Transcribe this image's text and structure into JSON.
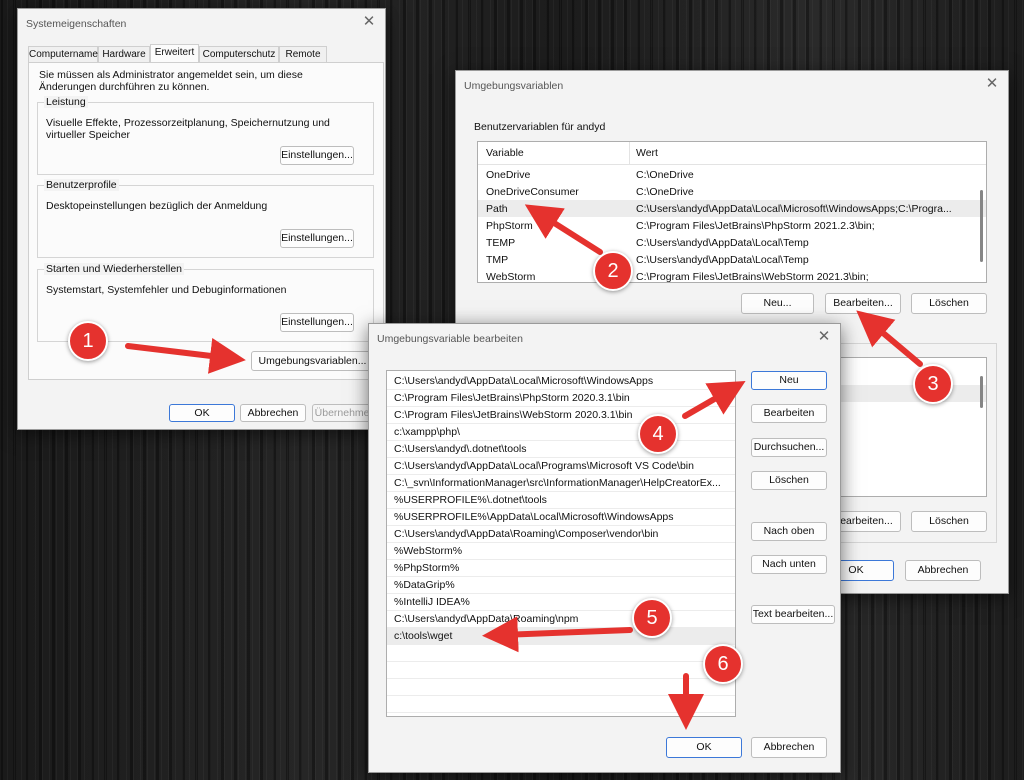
{
  "sys": {
    "title": "Systemeigenschaften",
    "tabs": [
      "Computername",
      "Hardware",
      "Erweitert",
      "Computerschutz",
      "Remote"
    ],
    "admin_note": "Sie müssen als Administrator angemeldet sein, um diese Änderungen durchführen zu können.",
    "leistung": {
      "title": "Leistung",
      "text": "Visuelle Effekte, Prozessorzeitplanung, Speichernutzung und virtueller Speicher",
      "button": "Einstellungen..."
    },
    "profile": {
      "title": "Benutzerprofile",
      "text": "Desktopeinstellungen bezüglich der Anmeldung",
      "button": "Einstellungen..."
    },
    "start": {
      "title": "Starten und Wiederherstellen",
      "text": "Systemstart, Systemfehler und Debuginformationen",
      "button": "Einstellungen..."
    },
    "env_button": "Umgebungsvariablen...",
    "ok": "OK",
    "cancel": "Abbrechen",
    "apply": "Übernehmen"
  },
  "env": {
    "title": "Umgebungsvariablen",
    "user_group": "Benutzervariablen für andyd",
    "col_variable": "Variable",
    "col_value": "Wert",
    "rows": [
      {
        "name": "OneDrive",
        "value": "C:\\OneDrive"
      },
      {
        "name": "OneDriveConsumer",
        "value": "C:\\OneDrive"
      },
      {
        "name": "Path",
        "value": "C:\\Users\\andyd\\AppData\\Local\\Microsoft\\WindowsApps;C:\\Progra..."
      },
      {
        "name": "PhpStorm",
        "value": "C:\\Program Files\\JetBrains\\PhpStorm 2021.2.3\\bin;"
      },
      {
        "name": "TEMP",
        "value": "C:\\Users\\andyd\\AppData\\Local\\Temp"
      },
      {
        "name": "TMP",
        "value": "C:\\Users\\andyd\\AppData\\Local\\Temp"
      },
      {
        "name": "WebStorm",
        "value": "C:\\Program Files\\JetBrains\\WebStorm 2021.3\\bin;"
      }
    ],
    "new": "Neu...",
    "edit": "Bearbeiten...",
    "delete": "Löschen",
    "sys_edit": "Bearbeiten...",
    "sys_delete": "Löschen",
    "ok": "OK",
    "cancel": "Abbrechen"
  },
  "edit": {
    "title": "Umgebungsvariable bearbeiten",
    "entries": [
      "C:\\Users\\andyd\\AppData\\Local\\Microsoft\\WindowsApps",
      "C:\\Program Files\\JetBrains\\PhpStorm 2020.3.1\\bin",
      "C:\\Program Files\\JetBrains\\WebStorm 2020.3.1\\bin",
      "c:\\xampp\\php\\",
      "C:\\Users\\andyd\\.dotnet\\tools",
      "C:\\Users\\andyd\\AppData\\Local\\Programs\\Microsoft VS Code\\bin",
      "C:\\_svn\\InformationManager\\src\\InformationManager\\HelpCreatorEx...",
      "%USERPROFILE%\\.dotnet\\tools",
      "%USERPROFILE%\\AppData\\Local\\Microsoft\\WindowsApps",
      "C:\\Users\\andyd\\AppData\\Roaming\\Composer\\vendor\\bin",
      "%WebStorm%",
      "%PhpStorm%",
      "%DataGrip%",
      "%IntelliJ IDEA%",
      "C:\\Users\\andyd\\AppData\\Roaming\\npm",
      "c:\\tools\\wget"
    ],
    "buttons": {
      "new": "Neu",
      "edit": "Bearbeiten",
      "browse": "Durchsuchen...",
      "delete": "Löschen",
      "up": "Nach oben",
      "down": "Nach unten",
      "edit_text": "Text bearbeiten..."
    },
    "ok": "OK",
    "cancel": "Abbrechen"
  },
  "markers": [
    "1",
    "2",
    "3",
    "4",
    "5",
    "6"
  ],
  "colors": {
    "marker": "#e5322e",
    "arrow": "#e5322e",
    "selection": "#ececec",
    "focus_border": "#3c78d8"
  }
}
